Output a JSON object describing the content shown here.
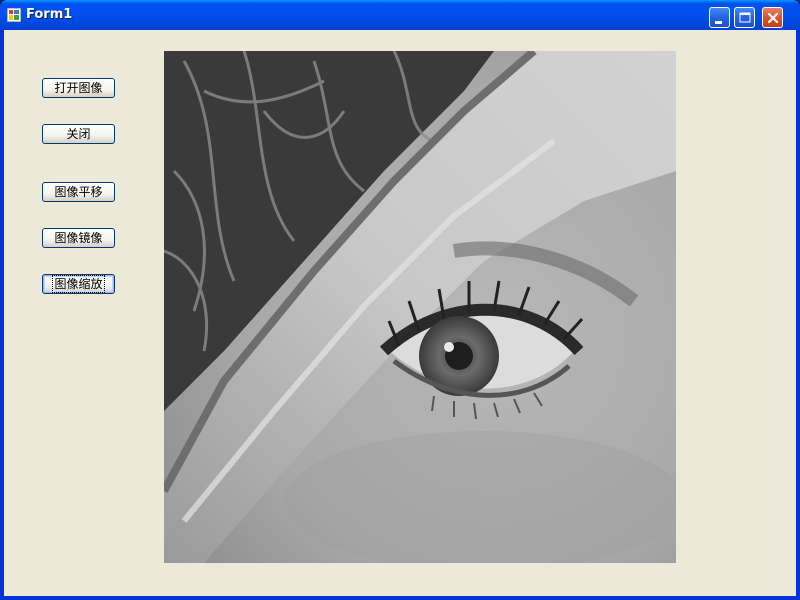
{
  "window": {
    "title": "Form1"
  },
  "buttons": {
    "open": "打开图像",
    "close": "关闭",
    "translate": "图像平移",
    "mirror": "图像镜像",
    "zoom": "图像缩放"
  },
  "image": {
    "subject": "grayscale-eye-photo"
  },
  "colors": {
    "titlebar": "#0053EE",
    "client": "#ECE9D8",
    "close_button": "#D8532E"
  }
}
